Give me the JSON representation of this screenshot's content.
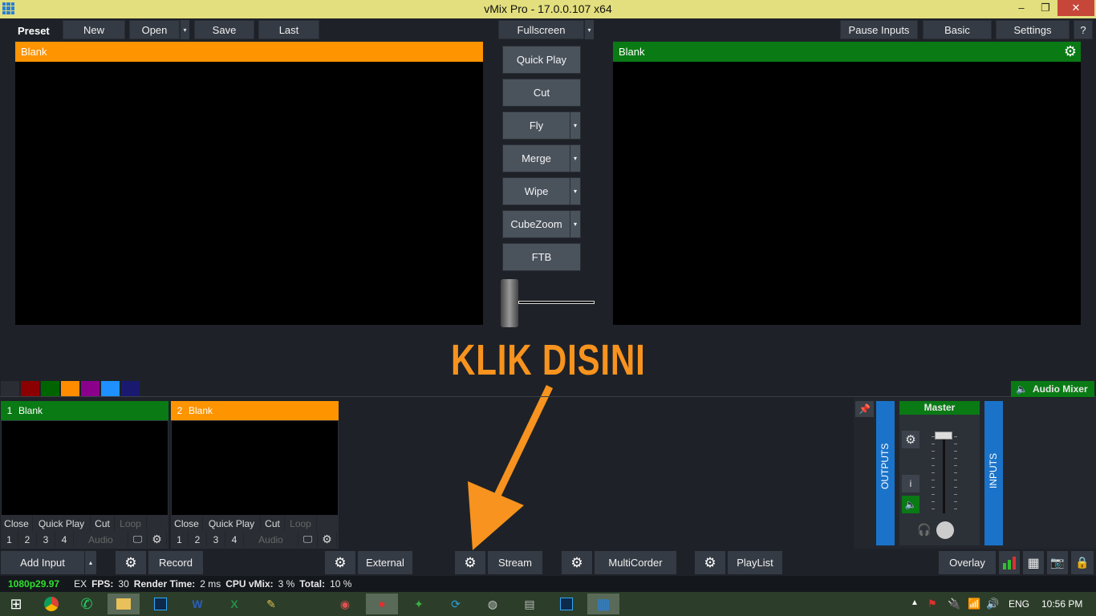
{
  "window": {
    "title": "vMix Pro - 17.0.0.107 x64",
    "min": "–",
    "max": "❐",
    "close": "✕"
  },
  "toolbar": {
    "preset": "Preset",
    "new": "New",
    "open": "Open",
    "save": "Save",
    "last": "Last",
    "fullscreen": "Fullscreen",
    "pause_inputs": "Pause Inputs",
    "basic": "Basic",
    "settings": "Settings",
    "help": "?"
  },
  "preview": {
    "label": "Blank",
    "color": "#fd9400"
  },
  "output": {
    "label": "Blank",
    "color": "#0a7a14"
  },
  "transitions": {
    "quick_play": "Quick Play",
    "cut": "Cut",
    "fly": "Fly",
    "merge": "Merge",
    "wipe": "Wipe",
    "cubezoom": "CubeZoom",
    "ftb": "FTB"
  },
  "annotation": {
    "text": "KLIK DISINI",
    "color": "#f7931e"
  },
  "color_swatches": [
    "#2a2e34",
    "#8b0000",
    "#006400",
    "#ff8c00",
    "#8b008b",
    "#1e90ff",
    "#191970"
  ],
  "audio_mixer": {
    "label": "Audio Mixer",
    "master": "Master",
    "outputs": "OUTPUTS",
    "inputs": "INPUTS",
    "info": "i"
  },
  "inputs": [
    {
      "number": "1",
      "label": "Blank",
      "color": "#0a7a14",
      "actions": [
        "Close",
        "Quick Play",
        "Cut",
        "Loop"
      ],
      "overlays": [
        "1",
        "2",
        "3",
        "4"
      ],
      "audio": "Audio"
    },
    {
      "number": "2",
      "label": "Blank",
      "color": "#fd9400",
      "actions": [
        "Close",
        "Quick Play",
        "Cut",
        "Loop"
      ],
      "overlays": [
        "1",
        "2",
        "3",
        "4"
      ],
      "audio": "Audio"
    }
  ],
  "bottom_bar": {
    "add_input": "Add Input",
    "record": "Record",
    "external": "External",
    "stream": "Stream",
    "multicorder": "MultiCorder",
    "playlist": "PlayList",
    "overlay": "Overlay"
  },
  "status": {
    "format": "1080p29.97",
    "ex": "EX",
    "fps_label": "FPS:",
    "fps": "30",
    "render_label": "Render Time:",
    "render": "2 ms",
    "cpu_label": "CPU vMix:",
    "cpu": "3 %",
    "total_label": "Total:",
    "total": "10 %"
  },
  "taskbar": {
    "language": "ENG",
    "time": "10:56 PM"
  }
}
